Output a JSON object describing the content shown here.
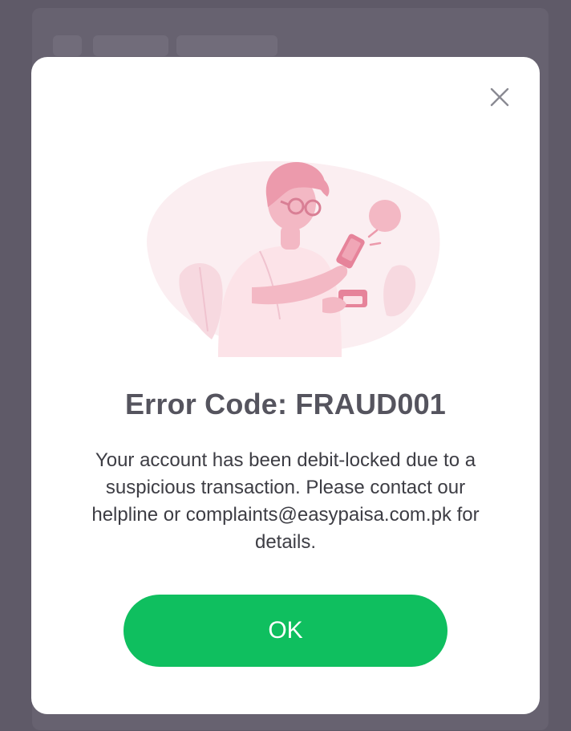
{
  "dialog": {
    "close_icon": "close-icon",
    "illustration_icon": "person-using-phone-illustration",
    "title": "Error Code: FRAUD001",
    "message": "Your account has been debit-locked due to a suspicious transaction. Please contact our helpline or complaints@easypaisa.com.pk for details.",
    "ok_label": "OK"
  },
  "colors": {
    "overlay": "#5f5a68",
    "accent": "#0fbf5f",
    "title_text": "#55545e",
    "illustration_pink": "#f3b8c4"
  }
}
